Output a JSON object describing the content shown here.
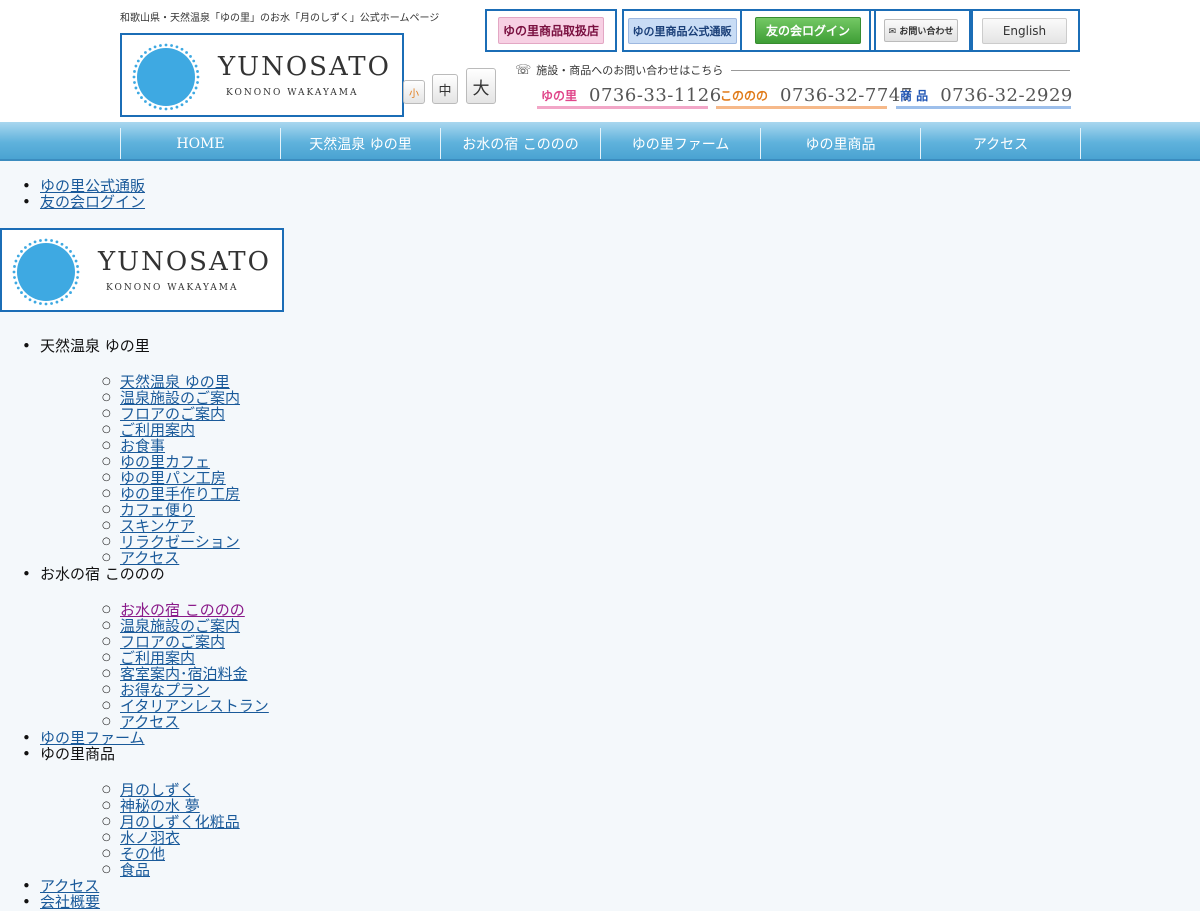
{
  "header": {
    "tagline": "和歌山県・天然温泉「ゆの里」のお水「月のしずく」公式ホームページ",
    "logo": {
      "word": "YUNOSATO",
      "sub": "KONONO  WAKAYAMA"
    },
    "font_size": {
      "small": "小",
      "medium": "中",
      "large": "大"
    },
    "top_buttons": {
      "dealers": "ゆの里商品取扱店",
      "shop": "ゆの里商品公式通販",
      "login": "友の会ログイン",
      "contact": "お問い合わせ",
      "english": "English"
    },
    "phone_heading": "施設・商品へのお問い合わせはこちら",
    "phones": [
      {
        "label": "ゆの里",
        "number": "0736-33-1126"
      },
      {
        "label": "こののの",
        "number": "0736-32-7747"
      },
      {
        "label": "商 品",
        "number": "0736-32-2929"
      }
    ]
  },
  "nav": [
    "HOME",
    "天然温泉 ゆの里",
    "お水の宿 こののの",
    "ゆの里ファーム",
    "ゆの里商品",
    "アクセス"
  ],
  "utility_links": [
    "ゆの里公式通販",
    "友の会ログイン"
  ],
  "menu": {
    "onsen": {
      "label": "天然温泉 ゆの里",
      "items": [
        "天然温泉 ゆの里",
        "温泉施設のご案内",
        "フロアのご案内",
        "ご利用案内",
        "お食事",
        "ゆの里カフェ",
        "ゆの里パン工房",
        "ゆの里手作り工房",
        "カフェ便り",
        "スキンケア",
        "リラクゼーション",
        "アクセス"
      ]
    },
    "inn": {
      "label": "お水の宿 こののの",
      "items": [
        "お水の宿 こののの",
        "温泉施設のご案内",
        "フロアのご案内",
        "ご利用案内",
        "客室案内･宿泊料金",
        "お得なプラン",
        "イタリアンレストラン",
        "アクセス"
      ]
    },
    "farm": {
      "label": "ゆの里ファーム"
    },
    "products": {
      "label": "ゆの里商品",
      "items": [
        "月のしずく",
        "神秘の水 夢",
        "月のしずく化粧品",
        "水ノ羽衣",
        "その他",
        "食品"
      ]
    },
    "access": {
      "label": "アクセス"
    },
    "company": {
      "label": "会社概要"
    }
  },
  "colors": {
    "accent": "#1b6db6",
    "nav": "#5fb2dc",
    "logo_sun": "#3ea9e2"
  }
}
